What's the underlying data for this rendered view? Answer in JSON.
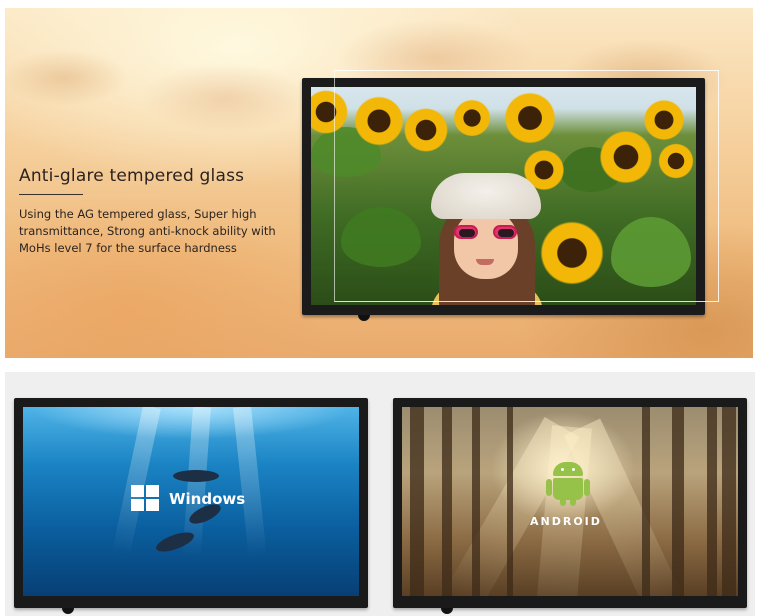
{
  "hero": {
    "title": "Anti-glare tempered glass",
    "description": "Using the AG tempered glass,  Super high transmittance, Strong anti-knock ability with MoHs level 7 for the surface hardness"
  },
  "products": [
    {
      "os_label": "Windows",
      "icon": "windows-logo-icon"
    },
    {
      "os_label": "ANDROID",
      "icon": "android-robot-icon"
    }
  ],
  "colors": {
    "hero_text": "#2b2320",
    "panel_bg": "#efefef",
    "bezel": "#1b1b1b",
    "android_green": "#97c24a"
  }
}
